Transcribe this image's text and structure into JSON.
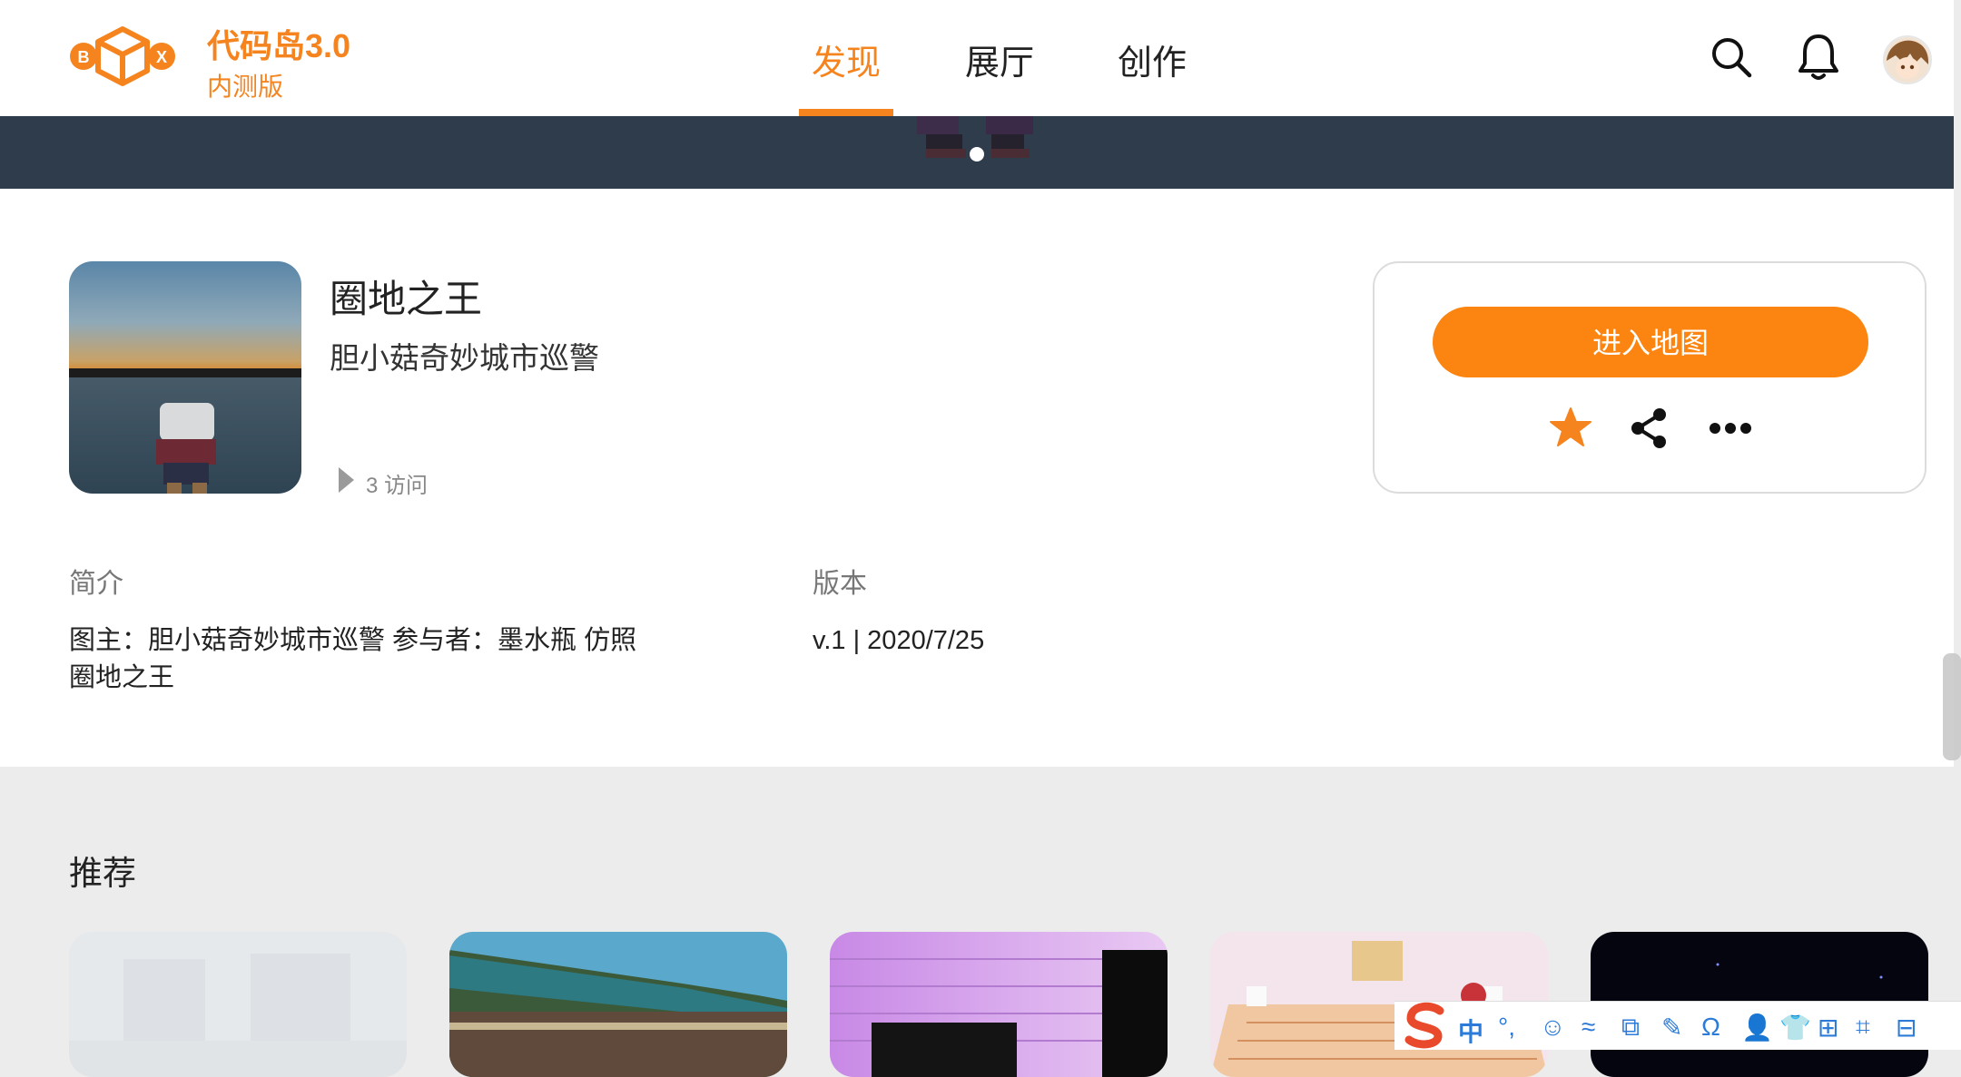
{
  "header": {
    "brand_name": "代码岛3.0",
    "brand_sub": "内测版",
    "logo_letters": [
      "B",
      "X"
    ],
    "tabs": [
      {
        "label": "发现",
        "active": true
      },
      {
        "label": "展厅",
        "active": false
      },
      {
        "label": "创作",
        "active": false
      }
    ],
    "icons": [
      "search-icon",
      "bell-icon",
      "avatar"
    ]
  },
  "map": {
    "title": "圈地之王",
    "author": "胆小菇奇妙城市巡警",
    "visits": "3 访问"
  },
  "actions": {
    "enter_label": "进入地图",
    "icons": [
      "star-icon",
      "share-icon",
      "more-icon"
    ]
  },
  "details": {
    "intro_label": "简介",
    "intro_text_line1": "图主：胆小菇奇妙城市巡警 参与者：墨水瓶 仿照",
    "intro_text_line2": "圈地之王",
    "version_label": "版本",
    "version_text": "v.1 | 2020/7/25"
  },
  "recommend": {
    "title": "推荐",
    "card_count": 5
  },
  "ime": {
    "char": "中",
    "symbols": [
      "°,",
      "☺",
      "≈",
      "⧉",
      "✎",
      "Ω",
      "👤",
      "👕",
      "⊞",
      "⌗",
      "⊟"
    ]
  },
  "colors": {
    "accent": "#f5841f",
    "button": "#fb8510",
    "banner": "#2f3c4b",
    "section_bg": "#ececec"
  }
}
